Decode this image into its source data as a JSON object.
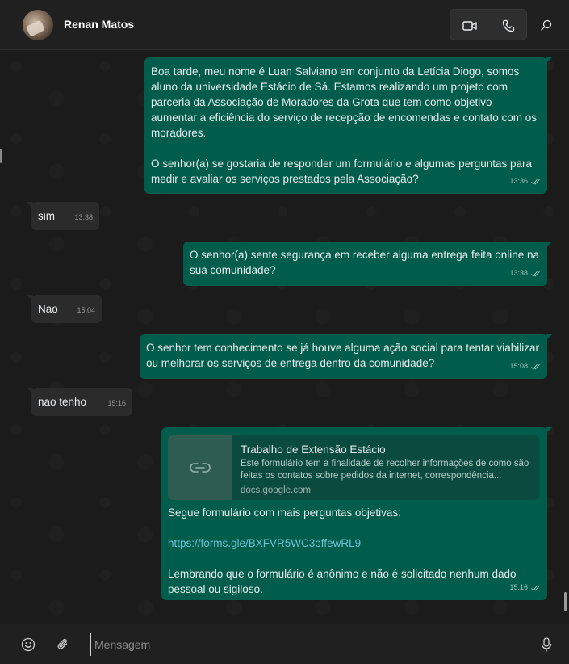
{
  "header": {
    "contact_name": "Renan Matos",
    "icons": [
      "avatar",
      "video-icon",
      "phone-icon",
      "search-icon"
    ]
  },
  "messages": [
    {
      "direction": "outgoing",
      "paragraphs": [
        "Boa tarde, meu nome é Luan Salviano em conjunto da Letícia Diogo, somos aluno da universidade Estácio de Sá. Estamos realizando um projeto com parceria da Associação de Moradores da Grota que tem como objetivo aumentar a eficiência do serviço de recepção de encomendas e contato com os moradores.",
        "O senhor(a) se gostaria de responder um formulário e algumas perguntas para medir e avaliar os serviços prestados pela Associação?"
      ],
      "time": "13:36",
      "status": "read"
    },
    {
      "direction": "incoming",
      "text": "sim",
      "time": "13:38"
    },
    {
      "direction": "outgoing",
      "text": "O senhor(a) sente segurança em receber alguma entrega feita online na sua comunidade?",
      "time": "13:38",
      "status": "read"
    },
    {
      "direction": "incoming",
      "text": "Nao",
      "time": "15:04"
    },
    {
      "direction": "outgoing",
      "text": "O senhor tem conhecimento se já houve alguma ação social para tentar viabilizar ou melhorar os serviços de entrega dentro da comunidade?",
      "time": "15:08",
      "status": "read"
    },
    {
      "direction": "incoming",
      "text": "nao tenho",
      "time": "15:16"
    },
    {
      "direction": "outgoing",
      "link_preview": {
        "title": "Trabalho de Extensão Estácio",
        "description": "Este formulário tem a finalidade de recolher informações de como são feitas os contatos sobre pedidos da internet, correspondência...",
        "domain": "docs.google.com",
        "icon": "link-icon"
      },
      "intro": "Segue formulário com mais perguntas objetivas:",
      "link": "https://forms.gle/BXFVR5WC3offewRL9",
      "outro": "Lembrando que o formulário é anônimo e não é solicitado nenhum dado pessoal ou sigiloso.",
      "time": "15:16",
      "status": "read"
    }
  ],
  "composer": {
    "placeholder": "Mensagem",
    "icons": [
      "emoji-icon",
      "attach-icon",
      "mic-icon"
    ]
  },
  "colors": {
    "outgoing_bubble": "#005c4b",
    "incoming_bubble": "#2b2b2b",
    "background": "#1b1b1b",
    "link": "#6ac2d6"
  }
}
